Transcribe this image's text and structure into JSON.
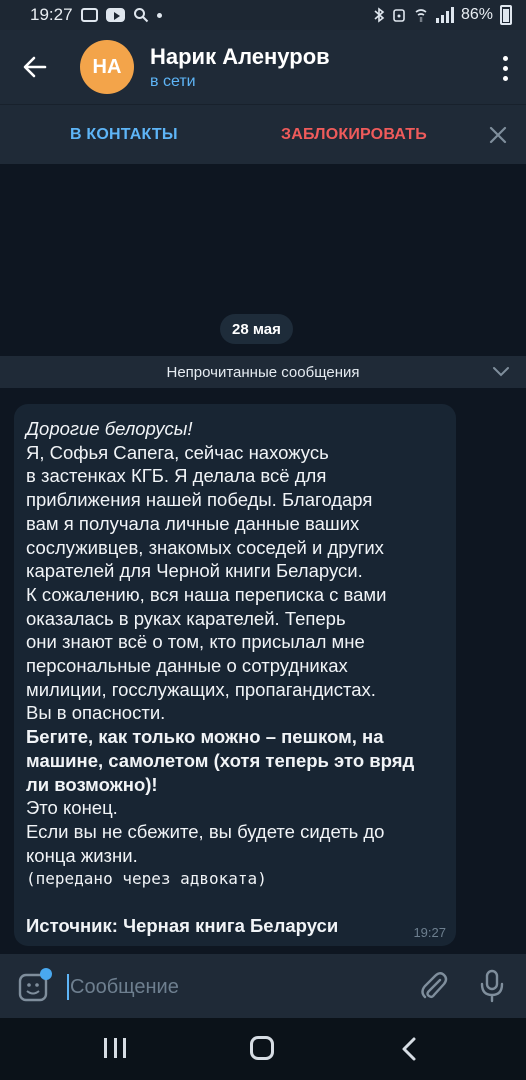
{
  "statusbar": {
    "time": "19:27",
    "battery": "86%"
  },
  "header": {
    "avatar_initials": "НА",
    "avatar_color": "#f3a44a",
    "name": "Нарик Аленуров",
    "status": "в сети"
  },
  "actions": {
    "add_contact": "В КОНТАКТЫ",
    "block": "ЗАБЛОКИРОВАТЬ"
  },
  "chat": {
    "date": "28 мая",
    "unread_label": "Непрочитанные сообщения",
    "message": {
      "lines": [
        "Дорогие белорусы!",
        "Я, Софья Сапега, сейчас нахожусь",
        "в застенках КГБ. Я делала всё для",
        "приближения нашей победы. Благодаря",
        "вам я получала личные данные ваших",
        "сослуживцев, знакомых соседей и других",
        "карателей для Черной книги Беларуси.",
        "К сожалению, вся наша переписка с вами",
        "оказалась в руках карателей. Теперь",
        "они знают всё о том, кто присылал мне",
        "персональные данные о сотрудниках",
        "милиции, госслужащих, пропагандистах.",
        "Вы в опасности.",
        "Бегите, как только можно – пешком, на",
        "машине, самолетом (хотя теперь это вряд",
        "ли возможно)!",
        "Это конец.",
        "Если вы не сбежите, вы будете сидеть до",
        "конца жизни.",
        "(передано через адвоката)",
        "Источник: Черная книга Беларуси"
      ],
      "time": "19:27"
    }
  },
  "input": {
    "placeholder": "Сообщение"
  },
  "colors": {
    "background": "#0e1621",
    "header": "#1f2a37",
    "bubble": "#182533",
    "accent": "#5eb5f7",
    "danger": "#ef5b5b"
  }
}
